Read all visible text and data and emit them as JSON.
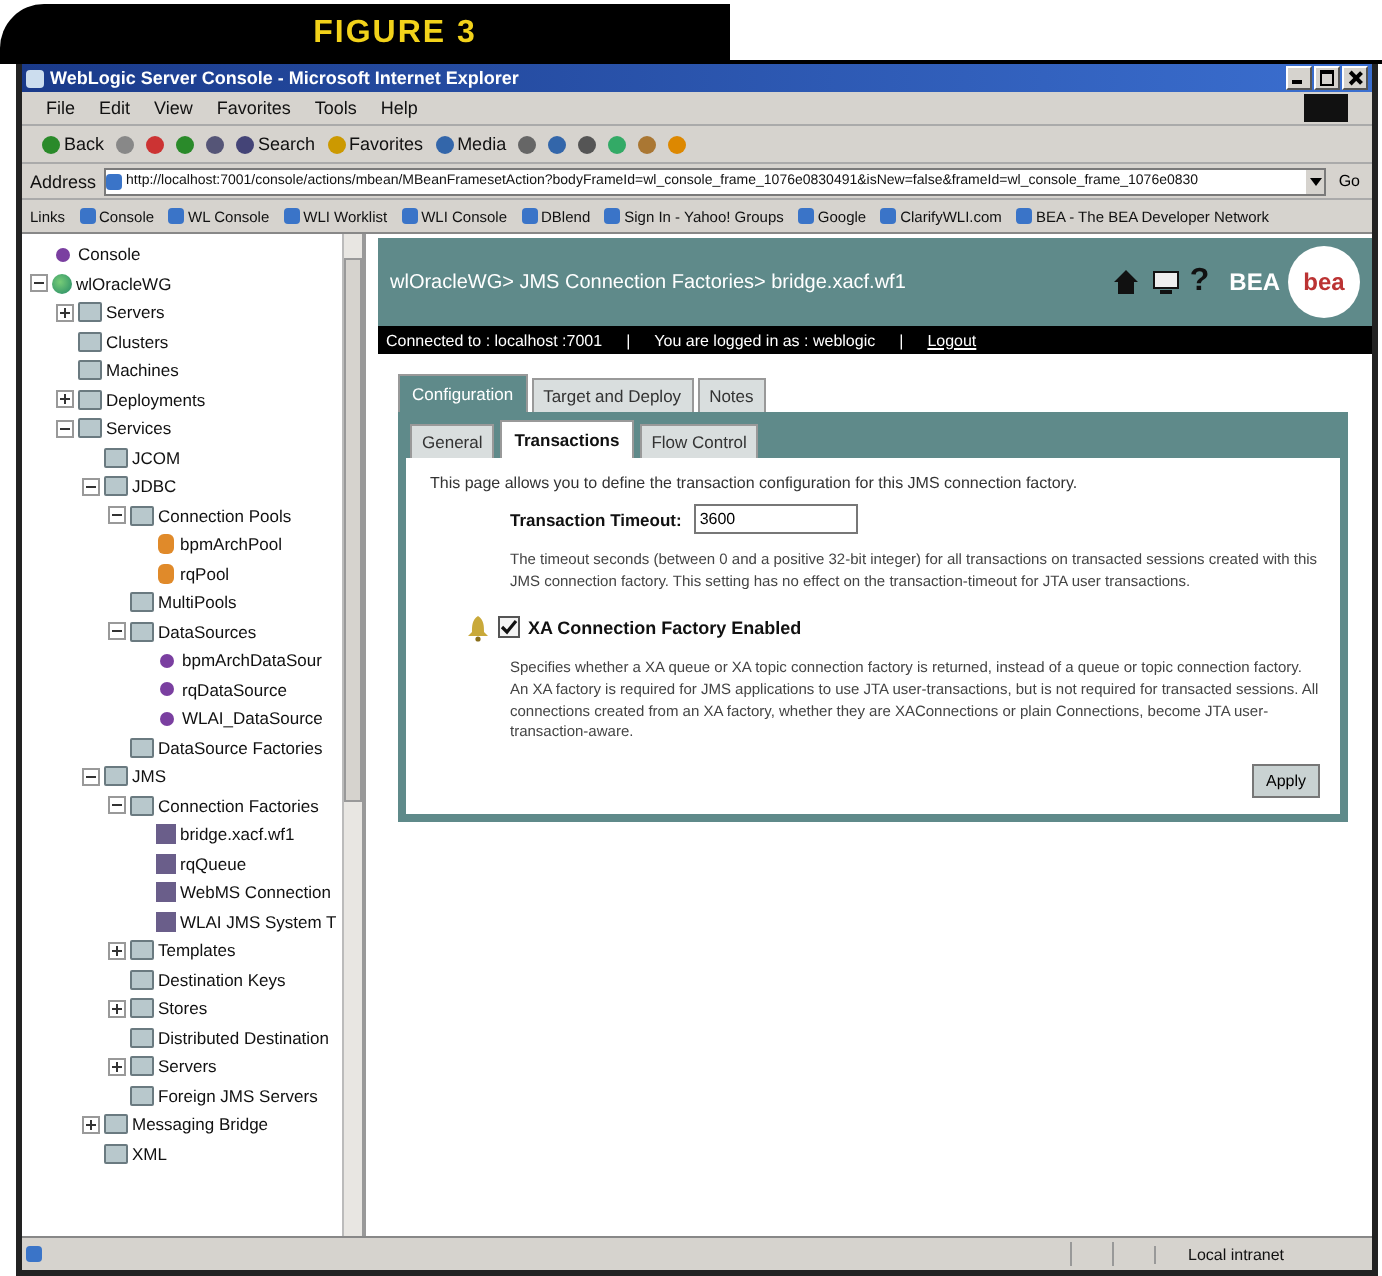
{
  "figure_label": "FIGURE 3",
  "window": {
    "title": "WebLogic Server Console - Microsoft Internet Explorer"
  },
  "menu": [
    "File",
    "Edit",
    "View",
    "Favorites",
    "Tools",
    "Help"
  ],
  "toolbar": [
    {
      "kind": "back",
      "label": "Back"
    },
    {
      "kind": "forward"
    },
    {
      "kind": "stop"
    },
    {
      "kind": "refresh"
    },
    {
      "kind": "home"
    },
    {
      "kind": "search",
      "label": "Search"
    },
    {
      "kind": "favorites",
      "label": "Favorites"
    },
    {
      "kind": "media",
      "label": "Media"
    },
    {
      "kind": "history"
    },
    {
      "kind": "mail"
    },
    {
      "kind": "print"
    },
    {
      "kind": "edit"
    },
    {
      "kind": "discuss"
    },
    {
      "kind": "messenger"
    }
  ],
  "address": {
    "label": "Address",
    "value": "http://localhost:7001/console/actions/mbean/MBeanFramesetAction?bodyFrameId=wl_console_frame_1076e0830491&isNew=false&frameId=wl_console_frame_1076e0830",
    "go": "Go"
  },
  "links": {
    "label": "Links",
    "items": [
      "Console",
      "WL Console",
      "WLI Worklist",
      "WLI Console",
      "DBlend",
      "Sign In - Yahoo! Groups",
      "Google",
      "ClarifyWLI.com",
      "BEA - The BEA Developer Network"
    ]
  },
  "tree": [
    {
      "label": "Console",
      "kind": "console"
    },
    {
      "label": "wlOracleWG",
      "kind": "domain",
      "expanded": true,
      "children": [
        {
          "label": "Servers",
          "kind": "folder",
          "expanded": false
        },
        {
          "label": "Clusters",
          "kind": "folder"
        },
        {
          "label": "Machines",
          "kind": "folder"
        },
        {
          "label": "Deployments",
          "kind": "folder",
          "expanded": false
        },
        {
          "label": "Services",
          "kind": "folder",
          "expanded": true,
          "children": [
            {
              "label": "JCOM",
              "kind": "folder"
            },
            {
              "label": "JDBC",
              "kind": "folder",
              "expanded": true,
              "children": [
                {
                  "label": "Connection Pools",
                  "kind": "folder",
                  "expanded": true,
                  "children": [
                    {
                      "label": "bpmArchPool",
                      "kind": "pool"
                    },
                    {
                      "label": "rqPool",
                      "kind": "pool"
                    }
                  ]
                },
                {
                  "label": "MultiPools",
                  "kind": "folder"
                },
                {
                  "label": "DataSources",
                  "kind": "folder",
                  "expanded": true,
                  "children": [
                    {
                      "label": "bpmArchDataSour",
                      "kind": "datasource"
                    },
                    {
                      "label": "rqDataSource",
                      "kind": "datasource"
                    },
                    {
                      "label": "WLAI_DataSource",
                      "kind": "datasource"
                    }
                  ]
                },
                {
                  "label": "DataSource Factories",
                  "kind": "folder"
                }
              ]
            },
            {
              "label": "JMS",
              "kind": "folder",
              "expanded": true,
              "children": [
                {
                  "label": "Connection Factories",
                  "kind": "folder",
                  "expanded": true,
                  "children": [
                    {
                      "label": "bridge.xacf.wf1",
                      "kind": "factory"
                    },
                    {
                      "label": "rqQueue",
                      "kind": "factory"
                    },
                    {
                      "label": "WebMS Connection",
                      "kind": "factory"
                    },
                    {
                      "label": "WLAI JMS System T",
                      "kind": "factory"
                    }
                  ]
                },
                {
                  "label": "Templates",
                  "kind": "folder",
                  "expanded": false
                },
                {
                  "label": "Destination Keys",
                  "kind": "folder"
                },
                {
                  "label": "Stores",
                  "kind": "folder",
                  "expanded": false
                },
                {
                  "label": "Distributed Destination",
                  "kind": "folder"
                },
                {
                  "label": "Servers",
                  "kind": "folder",
                  "expanded": false
                },
                {
                  "label": "Foreign JMS Servers",
                  "kind": "folder"
                }
              ]
            },
            {
              "label": "Messaging Bridge",
              "kind": "folder",
              "expanded": false
            },
            {
              "label": "XML",
              "kind": "folder"
            }
          ]
        }
      ]
    }
  ],
  "header": {
    "help": "?",
    "breadcrumb": "wlOracleWG> JMS Connection Factories> bridge.xacf.wf1",
    "logo": "BEA",
    "badge": "bea"
  },
  "status_strip": {
    "connected": "Connected to : localhost :7001",
    "separator_1": "|",
    "user": "You are logged in as : weblogic",
    "separator_2": "|",
    "logout": "Logout"
  },
  "tabs": [
    {
      "label": "Configuration",
      "selected": true
    },
    {
      "label": "Target and Deploy",
      "selected": false
    },
    {
      "label": "Notes",
      "selected": false
    }
  ],
  "subtabs": [
    {
      "label": "General",
      "selected": false
    },
    {
      "label": "Transactions",
      "selected": true
    },
    {
      "label": "Flow Control",
      "selected": false
    }
  ],
  "intro": "This page allows you to define the transaction configuration for this JMS connection factory.",
  "timeout": {
    "label": "Transaction Timeout:",
    "value": "3600",
    "help": "The timeout seconds (between 0 and a positive 32-bit integer) for all transactions on transacted sessions created with this JMS connection factory. This setting has no effect on the transaction-timeout for JTA user transactions."
  },
  "xa": {
    "label": "XA Connection Factory Enabled",
    "checked": true,
    "help": "Specifies whether a XA queue or XA topic connection factory is returned, instead of a queue or topic connection factory. An XA factory is required for JMS applications to use JTA user-transactions, but is not required for transacted sessions. All connections created from an XA factory, whether they are XAConnections or plain Connections, become JTA user-transaction-aware."
  },
  "apply": "Apply",
  "status_bar": {
    "zone": "Local intranet"
  }
}
